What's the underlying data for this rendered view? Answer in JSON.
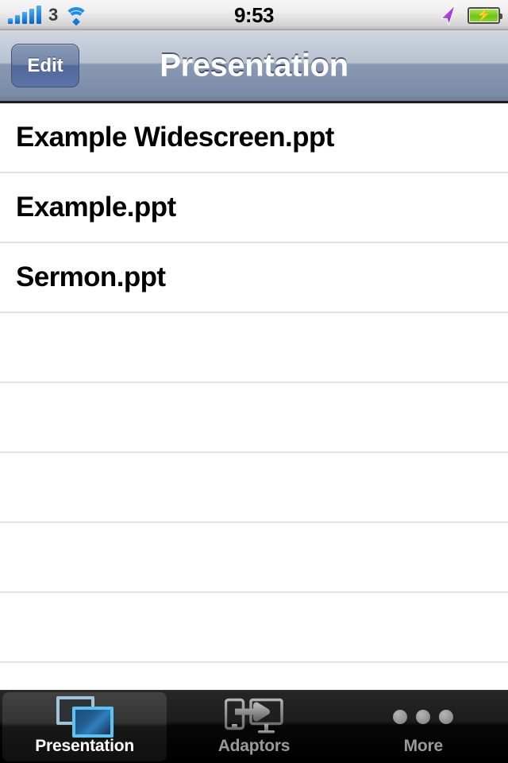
{
  "status_bar": {
    "signal_bars": 5,
    "carrier_label": "3",
    "wifi_icon": "wifi-icon",
    "time": "9:53",
    "location_icon": "location-arrow-icon",
    "battery_icon": "battery-charging-icon",
    "battery_charging": true
  },
  "nav_bar": {
    "edit_label": "Edit",
    "title": "Presentation"
  },
  "file_list": {
    "items": [
      {
        "name": "Example Widescreen.ppt"
      },
      {
        "name": "Example.ppt"
      },
      {
        "name": "Sermon.ppt"
      }
    ],
    "empty_row_count": 6
  },
  "tab_bar": {
    "active_index": 0,
    "tabs": [
      {
        "label": "Presentation",
        "icon": "slides-icon"
      },
      {
        "label": "Adaptors",
        "icon": "phone-to-monitor-icon"
      },
      {
        "label": "More",
        "icon": "ellipsis-icon"
      }
    ]
  },
  "colors": {
    "nav_top": "#cfd6e1",
    "nav_bottom": "#6d7e9c",
    "accent_blue": "#5ec2f0",
    "signal_blue": "#1479d6",
    "battery_green": "#6fc41a",
    "location_purple": "#a63de0",
    "tab_inactive": "#9a9a9a",
    "separator": "#e0e0e0"
  }
}
